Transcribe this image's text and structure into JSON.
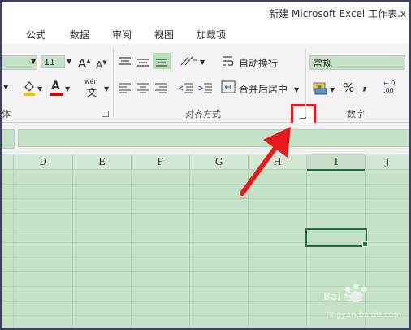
{
  "window": {
    "title": "新建 Microsoft Excel 工作表.x"
  },
  "tabs": [
    "公式",
    "数据",
    "审阅",
    "视图",
    "加载项"
  ],
  "ribbon": {
    "font": {
      "size": "11",
      "group_label": "体",
      "grow_icon": "A",
      "shrink_icon": "A",
      "underline_color": "#e8c400",
      "font_color": "#d00000",
      "wen_label": "wén"
    },
    "alignment": {
      "wrap_text_label": "自动换行",
      "merge_center_label": "合并后居中",
      "group_label": "对齐方式"
    },
    "number": {
      "format_value": "常规",
      "percent_label": "%",
      "comma_label": ",",
      "group_label": "数字"
    }
  },
  "columns": [
    "D",
    "E",
    "F",
    "G",
    "H",
    "I",
    "J"
  ],
  "selected_column": "I",
  "watermark": {
    "text": "Bai 经验",
    "url": "jingyan.baidu.com"
  },
  "colors": {
    "sheet_bg": "#c5e1c7",
    "annotation": "#e8191c",
    "selection": "#1e7145"
  }
}
